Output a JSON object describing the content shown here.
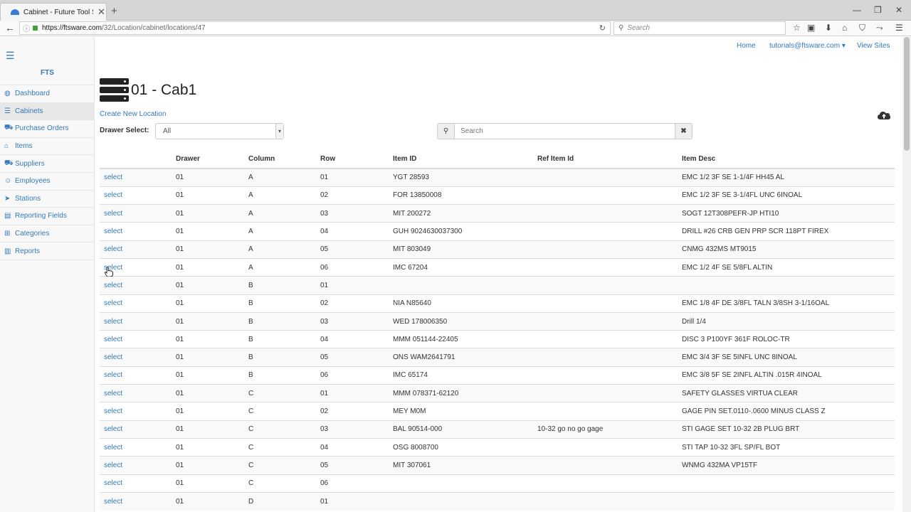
{
  "browser": {
    "tab_title": "Cabinet - Future Tool Syst...",
    "url_host": "https://ftsware.com",
    "url_path": "/32/Location/cabinet/locations/47",
    "search_placeholder": "Search"
  },
  "sidebar": {
    "brand": "FTS",
    "items": [
      {
        "label": "Dashboard",
        "icon": "dashboard-icon",
        "glyph": "◍"
      },
      {
        "label": "Cabinets",
        "icon": "cabinet-icon",
        "glyph": "☰"
      },
      {
        "label": "Purchase Orders",
        "icon": "cart-icon",
        "glyph": "⛟"
      },
      {
        "label": "Items",
        "icon": "tags-icon",
        "glyph": "⌂"
      },
      {
        "label": "Suppliers",
        "icon": "truck-icon",
        "glyph": "⛟"
      },
      {
        "label": "Employees",
        "icon": "users-icon",
        "glyph": "☺"
      },
      {
        "label": "Stations",
        "icon": "location-arrow-icon",
        "glyph": "➤"
      },
      {
        "label": "Reporting Fields",
        "icon": "book-icon",
        "glyph": "▤"
      },
      {
        "label": "Categories",
        "icon": "sitemap-icon",
        "glyph": "⊞"
      },
      {
        "label": "Reports",
        "icon": "bar-chart-icon",
        "glyph": "▥"
      }
    ],
    "active_index": 1
  },
  "topnav": {
    "home": "Home",
    "user": "tutorials@ftsware.com ▾",
    "view_sites": "View Sites"
  },
  "page": {
    "title": "01 - Cab1",
    "create_link": "Create New Location",
    "drawer_label": "Drawer Select:",
    "drawer_value": "All",
    "search_placeholder": "Search"
  },
  "table": {
    "headers": [
      "",
      "Drawer",
      "Column",
      "Row",
      "Item ID",
      "Ref Item Id",
      "Item Desc"
    ],
    "select_label": "select",
    "rows": [
      [
        "01",
        "A",
        "01",
        "YGT 28593",
        "",
        "EMC 1/2 3F SE 1-1/4F HH45 AL"
      ],
      [
        "01",
        "A",
        "02",
        "FOR 13850008",
        "",
        "EMC 1/2 3F SE 3-1/4FL UNC 6INOAL"
      ],
      [
        "01",
        "A",
        "03",
        "MIT 200272",
        "",
        "SOGT 12T308PEFR-JP HTI10"
      ],
      [
        "01",
        "A",
        "04",
        "GUH 9024630037300",
        "",
        "DRILL #26 CRB GEN PRP SCR 118PT FIREX"
      ],
      [
        "01",
        "A",
        "05",
        "MIT 803049",
        "",
        "CNMG 432MS MT9015"
      ],
      [
        "01",
        "A",
        "06",
        "IMC 67204",
        "",
        "EMC 1/2 4F SE 5/8FL ALTIN"
      ],
      [
        "01",
        "B",
        "01",
        "",
        "",
        ""
      ],
      [
        "01",
        "B",
        "02",
        "NIA N85640",
        "",
        "EMC 1/8 4F DE 3/8FL TALN 3/8SH 3-1/16OAL"
      ],
      [
        "01",
        "B",
        "03",
        "WED 178006350",
        "",
        "Drill 1/4"
      ],
      [
        "01",
        "B",
        "04",
        "MMM 051144-22405",
        "",
        "DISC 3 P100YF 361F ROLOC-TR"
      ],
      [
        "01",
        "B",
        "05",
        "ONS WAM2641791",
        "",
        "EMC 3/4 3F SE 5INFL UNC 8INOAL"
      ],
      [
        "01",
        "B",
        "06",
        "IMC 65174",
        "",
        "EMC 3/8 5F SE 2INFL ALTIN .015R 4INOAL"
      ],
      [
        "01",
        "C",
        "01",
        "MMM 078371-62120",
        "",
        "SAFETY GLASSES VIRTUA CLEAR"
      ],
      [
        "01",
        "C",
        "02",
        "MEY M0M",
        "",
        "GAGE PIN SET.0110-.0600 MINUS CLASS Z"
      ],
      [
        "01",
        "C",
        "03",
        "BAL 90514-000",
        "10-32 go no go gage",
        "STI GAGE SET 10-32 2B PLUG BRT"
      ],
      [
        "01",
        "C",
        "04",
        "OSG 8008700",
        "",
        "STI TAP 10-32 3FL SP/FL BOT"
      ],
      [
        "01",
        "C",
        "05",
        "MIT 307061",
        "",
        "WNMG 432MA VP15TF"
      ],
      [
        "01",
        "C",
        "06",
        "",
        "",
        ""
      ],
      [
        "01",
        "D",
        "01",
        "",
        "",
        ""
      ]
    ]
  }
}
